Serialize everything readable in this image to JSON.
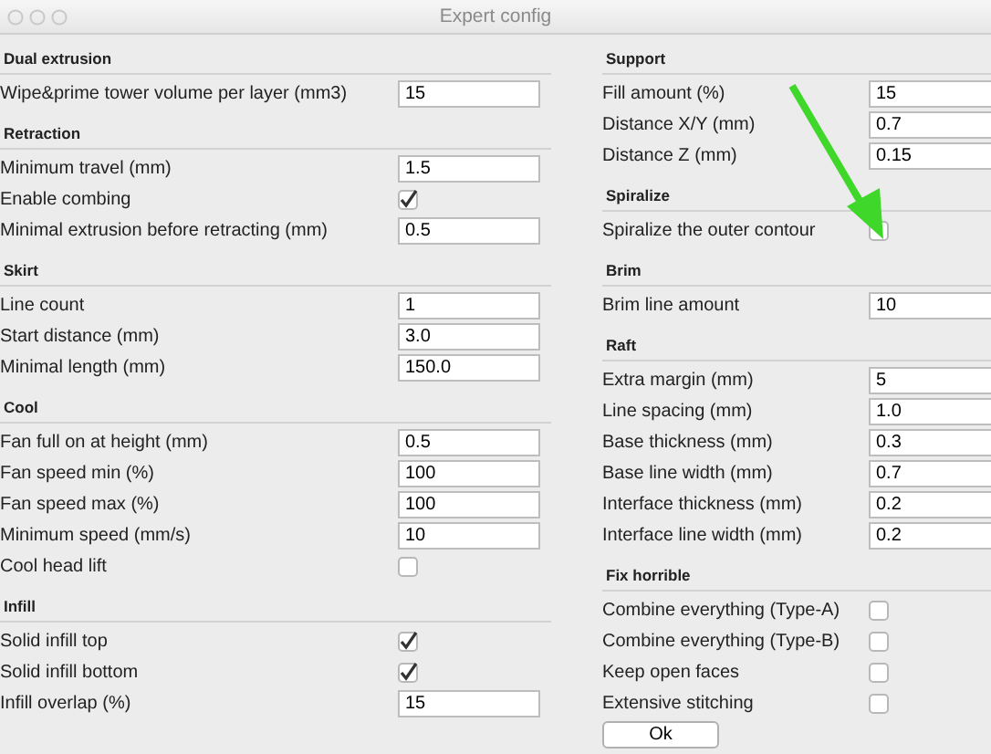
{
  "window": {
    "title": "Expert config"
  },
  "columns": [
    {
      "sections": [
        {
          "title": "Dual extrusion",
          "rows": [
            {
              "kind": "text",
              "label": "Wipe&prime tower volume per layer (mm3)",
              "value": "15"
            }
          ]
        },
        {
          "title": "Retraction",
          "rows": [
            {
              "kind": "text",
              "label": "Minimum travel (mm)",
              "value": "1.5"
            },
            {
              "kind": "check",
              "label": "Enable combing",
              "checked": true
            },
            {
              "kind": "text",
              "label": "Minimal extrusion before retracting (mm)",
              "value": "0.5"
            }
          ]
        },
        {
          "title": "Skirt",
          "rows": [
            {
              "kind": "text",
              "label": "Line count",
              "value": "1"
            },
            {
              "kind": "text",
              "label": "Start distance (mm)",
              "value": "3.0"
            },
            {
              "kind": "text",
              "label": "Minimal length (mm)",
              "value": "150.0"
            }
          ]
        },
        {
          "title": "Cool",
          "rows": [
            {
              "kind": "text",
              "label": "Fan full on at height (mm)",
              "value": "0.5"
            },
            {
              "kind": "text",
              "label": "Fan speed min (%)",
              "value": "100"
            },
            {
              "kind": "text",
              "label": "Fan speed max (%)",
              "value": "100"
            },
            {
              "kind": "text",
              "label": "Minimum speed (mm/s)",
              "value": "10"
            },
            {
              "kind": "check",
              "label": "Cool head lift",
              "checked": false
            }
          ]
        },
        {
          "title": "Infill",
          "rows": [
            {
              "kind": "check",
              "label": "Solid infill top",
              "checked": true
            },
            {
              "kind": "check",
              "label": "Solid infill bottom",
              "checked": true
            },
            {
              "kind": "text",
              "label": "Infill overlap (%)",
              "value": "15"
            }
          ]
        }
      ]
    },
    {
      "sections": [
        {
          "title": "Support",
          "rows": [
            {
              "kind": "text",
              "label": "Fill amount (%)",
              "value": "15"
            },
            {
              "kind": "text",
              "label": "Distance X/Y (mm)",
              "value": "0.7"
            },
            {
              "kind": "text",
              "label": "Distance Z (mm)",
              "value": "0.15"
            }
          ]
        },
        {
          "title": "Spiralize",
          "rows": [
            {
              "kind": "check",
              "label": "Spiralize the outer contour",
              "checked": false
            }
          ]
        },
        {
          "title": "Brim",
          "rows": [
            {
              "kind": "text",
              "label": "Brim line amount",
              "value": "10"
            }
          ]
        },
        {
          "title": "Raft",
          "rows": [
            {
              "kind": "text",
              "label": "Extra margin (mm)",
              "value": "5"
            },
            {
              "kind": "text",
              "label": "Line spacing (mm)",
              "value": "1.0"
            },
            {
              "kind": "text",
              "label": "Base thickness (mm)",
              "value": "0.3"
            },
            {
              "kind": "text",
              "label": "Base line width (mm)",
              "value": "0.7"
            },
            {
              "kind": "text",
              "label": "Interface thickness (mm)",
              "value": "0.2"
            },
            {
              "kind": "text",
              "label": "Interface line width (mm)",
              "value": "0.2"
            }
          ]
        },
        {
          "title": "Fix horrible",
          "rows": [
            {
              "kind": "check",
              "label": "Combine everything (Type-A)",
              "checked": false
            },
            {
              "kind": "check",
              "label": "Combine everything (Type-B)",
              "checked": false
            },
            {
              "kind": "check",
              "label": "Keep open faces",
              "checked": false
            },
            {
              "kind": "check",
              "label": "Extensive stitching",
              "checked": false
            }
          ]
        }
      ]
    }
  ],
  "buttons": [
    "Ok"
  ]
}
